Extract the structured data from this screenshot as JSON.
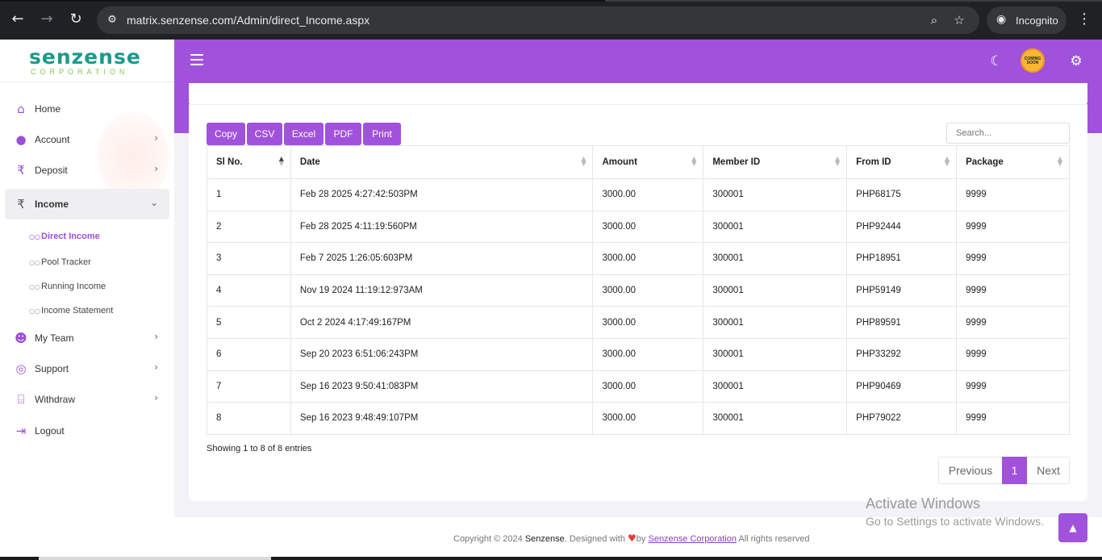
{
  "browser": {
    "url": "matrix.senzense.com/Admin/direct_Income.aspx",
    "incognito_label": "Incognito"
  },
  "logo": {
    "main": "senzense",
    "sub": "CORPORATION"
  },
  "sidebar": {
    "items": [
      {
        "label": "Home",
        "icon": "home-icon"
      },
      {
        "label": "Account",
        "icon": "user-icon"
      },
      {
        "label": "Deposit",
        "icon": "rupee-icon"
      },
      {
        "label": "Income",
        "icon": "rupee-icon"
      },
      {
        "label": "My Team",
        "icon": "team-icon"
      },
      {
        "label": "Support",
        "icon": "support-icon"
      },
      {
        "label": "Withdraw",
        "icon": "bank-icon"
      },
      {
        "label": "Logout",
        "icon": "logout-icon"
      }
    ],
    "income_sub": [
      {
        "label": "Direct Income"
      },
      {
        "label": "Pool Tracker"
      },
      {
        "label": "Running Income"
      },
      {
        "label": "Income Statement"
      }
    ]
  },
  "header": {
    "coin_label": "COMING SOON"
  },
  "toolbar": {
    "copy": "Copy",
    "csv": "CSV",
    "excel": "Excel",
    "pdf": "PDF",
    "print": "Print"
  },
  "search": {
    "placeholder": "Search..."
  },
  "table": {
    "headers": [
      "Sl No.",
      "Date",
      "Amount",
      "Member ID",
      "From ID",
      "Package"
    ],
    "rows": [
      [
        "1",
        "Feb 28 2025 4:27:42:503PM",
        "3000.00",
        "300001",
        "PHP68175",
        "9999"
      ],
      [
        "2",
        "Feb 28 2025 4:11:19:560PM",
        "3000.00",
        "300001",
        "PHP92444",
        "9999"
      ],
      [
        "3",
        "Feb 7 2025 1:26:05:603PM",
        "3000.00",
        "300001",
        "PHP18951",
        "9999"
      ],
      [
        "4",
        "Nov 19 2024 11:19:12:973AM",
        "3000.00",
        "300001",
        "PHP59149",
        "9999"
      ],
      [
        "5",
        "Oct 2 2024 4:17:49:167PM",
        "3000.00",
        "300001",
        "PHP89591",
        "9999"
      ],
      [
        "6",
        "Sep 20 2023 6:51:06:243PM",
        "3000.00",
        "300001",
        "PHP33292",
        "9999"
      ],
      [
        "7",
        "Sep 16 2023 9:50:41:083PM",
        "3000.00",
        "300001",
        "PHP90469",
        "9999"
      ],
      [
        "8",
        "Sep 16 2023 9:48:49:107PM",
        "3000.00",
        "300001",
        "PHP79022",
        "9999"
      ]
    ],
    "info": "Showing 1 to 8 of 8 entries"
  },
  "pagination": {
    "previous": "Previous",
    "current": "1",
    "next": "Next"
  },
  "footer": {
    "copyright": "Copyright © 2024 ",
    "brand": "Senzense",
    "designed": ". Designed with ",
    "by": "by ",
    "link": "Senzense Corporation",
    "rights": " All rights reserved"
  },
  "os_overlay": {
    "line1": "Activate Windows",
    "line2": "Go to Settings to activate Windows."
  },
  "colors": {
    "accent": "#a052dc",
    "logo_teal": "#1a9a8a",
    "logo_green": "#8bc34a"
  }
}
